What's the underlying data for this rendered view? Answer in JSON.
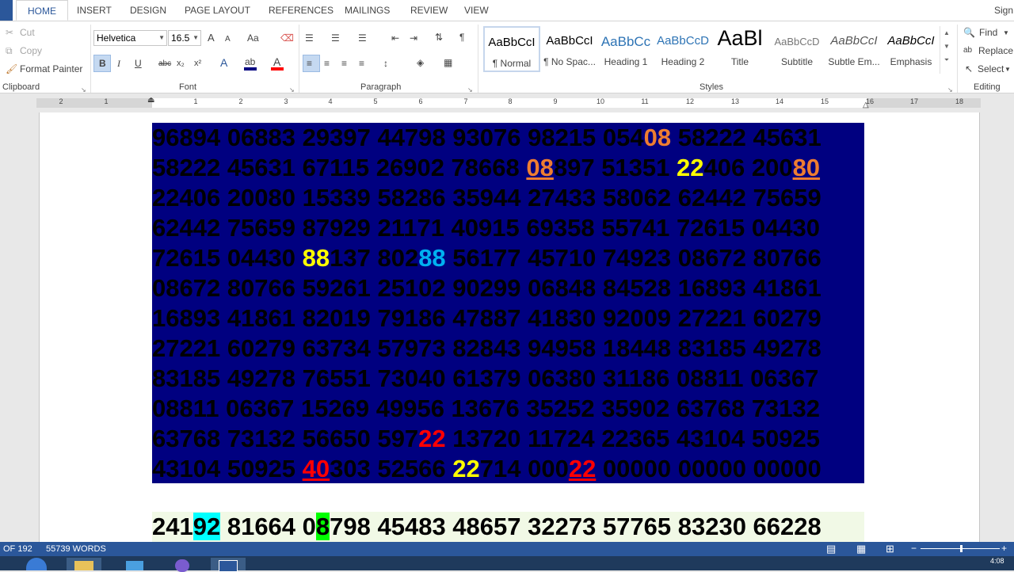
{
  "ribbon_tabs": [
    "HOME",
    "INSERT",
    "DESIGN",
    "PAGE LAYOUT",
    "REFERENCES",
    "MAILINGS",
    "REVIEW",
    "VIEW"
  ],
  "signin": "Sign",
  "clipboard": {
    "cut": "Cut",
    "copy": "Copy",
    "format_painter": "Format Painter",
    "label": "Clipboard"
  },
  "font": {
    "name": "Helvetica",
    "size": "16.5",
    "label": "Font",
    "bold": "B",
    "italic": "I",
    "underline": "U",
    "strike": "abc",
    "sub": "x₂",
    "sup": "x²",
    "grow": "A",
    "shrink": "A",
    "case": "Aa"
  },
  "paragraph": {
    "label": "Paragraph"
  },
  "styles": {
    "label": "Styles",
    "items": [
      {
        "preview": "AaBbCcI",
        "name": "¶ Normal"
      },
      {
        "preview": "AaBbCcI",
        "name": "¶ No Spac..."
      },
      {
        "preview": "AaBbCc",
        "name": "Heading 1"
      },
      {
        "preview": "AaBbCcD",
        "name": "Heading 2"
      },
      {
        "preview": "AaBl",
        "name": "Title"
      },
      {
        "preview": "AaBbCcD",
        "name": "Subtitle"
      },
      {
        "preview": "AaBbCcI",
        "name": "Subtle Em..."
      },
      {
        "preview": "AaBbCcI",
        "name": "Emphasis"
      }
    ]
  },
  "editing": {
    "find": "Find",
    "replace": "Replace",
    "select": "Select",
    "label": "Editing"
  },
  "ruler": {
    "numbers": [
      "2",
      "1",
      "1",
      "2",
      "3",
      "4",
      "5",
      "6",
      "7",
      "8",
      "9",
      "10",
      "11",
      "12",
      "13",
      "14",
      "15",
      "16",
      "17",
      "18"
    ]
  },
  "document": {
    "lines": [
      [
        {
          "t": "96894 06883 29397 44798 93076 98215 054"
        },
        {
          "t": "08",
          "c": "o"
        },
        {
          "t": " 58222 45631"
        }
      ],
      [
        {
          "t": "58222 45631 67115 26902 78668 "
        },
        {
          "t": "08",
          "c": "o",
          "u": true
        },
        {
          "t": "897 51351 "
        },
        {
          "t": "22",
          "c": "y"
        },
        {
          "t": "406 200"
        },
        {
          "t": "80",
          "c": "o",
          "u": true
        }
      ],
      [
        {
          "t": "22406 20080 15339 58286 35944 27433 58062 62442 75659"
        }
      ],
      [
        {
          "t": "62442 75659 87929 21171 40915 69358 55741 72615 04430"
        }
      ],
      [
        {
          "t": "72615 04430 "
        },
        {
          "t": "88",
          "c": "y"
        },
        {
          "t": "137 802"
        },
        {
          "t": "88",
          "c": "b"
        },
        {
          "t": " 56177 45710 74923 08672 80766"
        }
      ],
      [
        {
          "t": "08672 80766 59261 25102 90299 06848 84528 16893 41861"
        }
      ],
      [
        {
          "t": "16893 41861 82019 79186 47887 41830 92009 27221 60279"
        }
      ],
      [
        {
          "t": "27221 60279 63734 57973 82843 94958 18448 83185 49278"
        }
      ],
      [
        {
          "t": "83185 49278 76551 73040 61379 06380 31186 08811 06367"
        }
      ],
      [
        {
          "t": "08811 06367 15269 49956 13676 35252 35902 63768 73132"
        }
      ],
      [
        {
          "t": "63768 73132 56650 597"
        },
        {
          "t": "22",
          "c": "r"
        },
        {
          "t": " 13720 11724 22365 43104 50925"
        }
      ],
      [
        {
          "t": "43104 50925 "
        },
        {
          "t": "40",
          "c": "r",
          "u": true
        },
        {
          "t": "303 52566 "
        },
        {
          "t": "22",
          "c": "y"
        },
        {
          "t": "714 000"
        },
        {
          "t": "22",
          "c": "r",
          "u": true
        },
        {
          "t": " 00000 00000 00000"
        }
      ]
    ],
    "bottom_line": [
      {
        "t": "241"
      },
      {
        "t": "92",
        "bg": "c"
      },
      {
        "t": " 81664 0"
      },
      {
        "t": "8",
        "bg": "g"
      },
      {
        "t": "798 45483 48657 32273 57765 83230 66228"
      }
    ]
  },
  "status": {
    "page": "OF 192",
    "words": "55739 WORDS"
  },
  "clock": "4:08"
}
